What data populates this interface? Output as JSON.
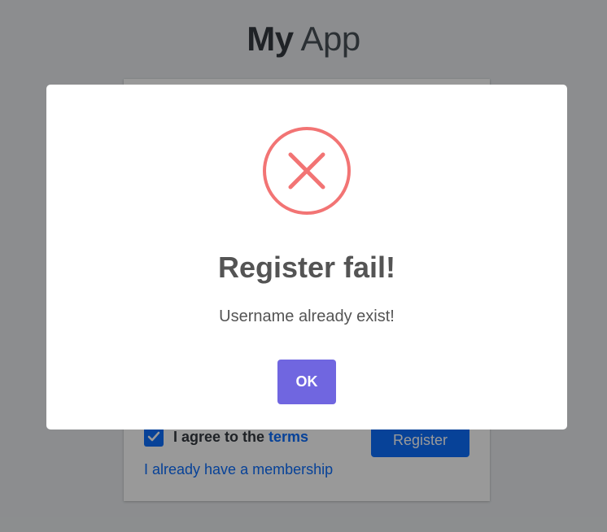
{
  "background": {
    "brand_bold": "My",
    "brand_light": "App",
    "agree_prefix": "I agree to the ",
    "agree_link": "terms",
    "agree_checked": true,
    "register_label": "Register",
    "membership_link": "I already have a membership"
  },
  "modal": {
    "icon": "error-x-icon",
    "title": "Register fail!",
    "text": "Username already exist!",
    "ok_label": "OK"
  },
  "colors": {
    "overlay": "rgba(0,0,0,0.4)",
    "error_icon": "#f27474",
    "ok_button": "#7066e0",
    "primary": "#0d6efd"
  }
}
